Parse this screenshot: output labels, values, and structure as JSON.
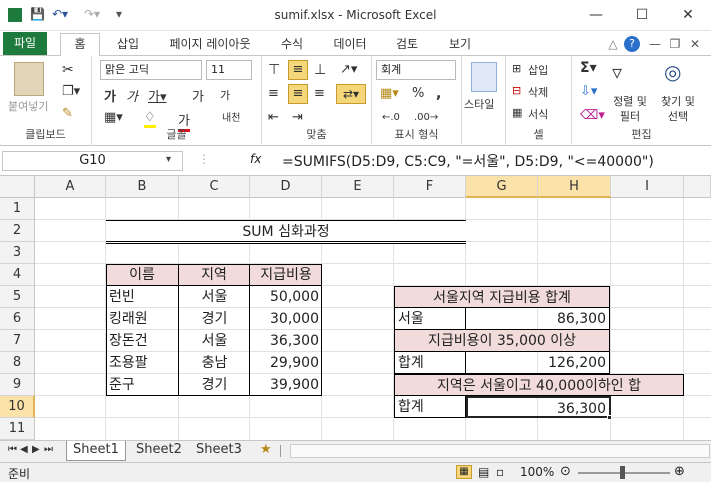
{
  "window": {
    "title": "sumif.xlsx  -  Microsoft Excel"
  },
  "ribbon_tabs": [
    "파일",
    "홈",
    "삽입",
    "페이지 레이아웃",
    "수식",
    "데이터",
    "검토",
    "보기"
  ],
  "ribbon": {
    "clipboard": {
      "paste": "붙여넣기",
      "label": "클립보드"
    },
    "font": {
      "name": "맑은 고딕",
      "size": "11",
      "bold": "가",
      "italic": "가",
      "grow": "가",
      "shrink": "가",
      "color_text": "가",
      "phonetic": "내천",
      "label": "글꼴"
    },
    "align": {
      "label": "맞춤"
    },
    "number": {
      "format": "회계",
      "percent": "%",
      "comma": ",",
      "label": "표시 형식"
    },
    "style": {
      "styles": "스타일"
    },
    "cells": {
      "insert": "삽입",
      "delete": "삭제",
      "format": "서식",
      "label": "셀"
    },
    "editing": {
      "sort": "정렬 및 필터",
      "find": "찾기 및 선택",
      "label": "편집"
    }
  },
  "formula_bar": {
    "name_box": "G10",
    "fx": "fx",
    "formula": "=SUMIFS(D5:D9, C5:C9, \"=서울\", D5:D9, \"<=40000\")"
  },
  "columns": [
    "A",
    "B",
    "C",
    "D",
    "E",
    "F",
    "G",
    "H",
    "I"
  ],
  "rows": [
    "1",
    "2",
    "3",
    "4",
    "5",
    "6",
    "7",
    "8",
    "9",
    "10",
    "11"
  ],
  "sheet": {
    "title": "SUM 심화과정",
    "headers": [
      "이름",
      "지역",
      "지급비용"
    ],
    "data": [
      [
        "런빈",
        "서울",
        "50,000"
      ],
      [
        "킹래원",
        "경기",
        "30,000"
      ],
      [
        "장돈건",
        "서울",
        "36,300"
      ],
      [
        "조용팔",
        "충남",
        "29,900"
      ],
      [
        "준구",
        "경기",
        "39,900"
      ]
    ],
    "box1_title": "서울지역 지급비용 합계",
    "box1_label": "서울",
    "box1_value": "86,300",
    "box2_title": "지급비용이 35,000 이상",
    "box2_label": "합계",
    "box2_value": "126,200",
    "box3_title": "지역은 서울이고 40,000이하인 합",
    "box3_label": "합계",
    "box3_value": "36,300"
  },
  "sheets": [
    "Sheet1",
    "Sheet2",
    "Sheet3"
  ],
  "status": {
    "mode": "준비",
    "zoom": "100%"
  },
  "colors": {
    "accent": "#1f7a3e",
    "pink": "#f2dcdb"
  }
}
